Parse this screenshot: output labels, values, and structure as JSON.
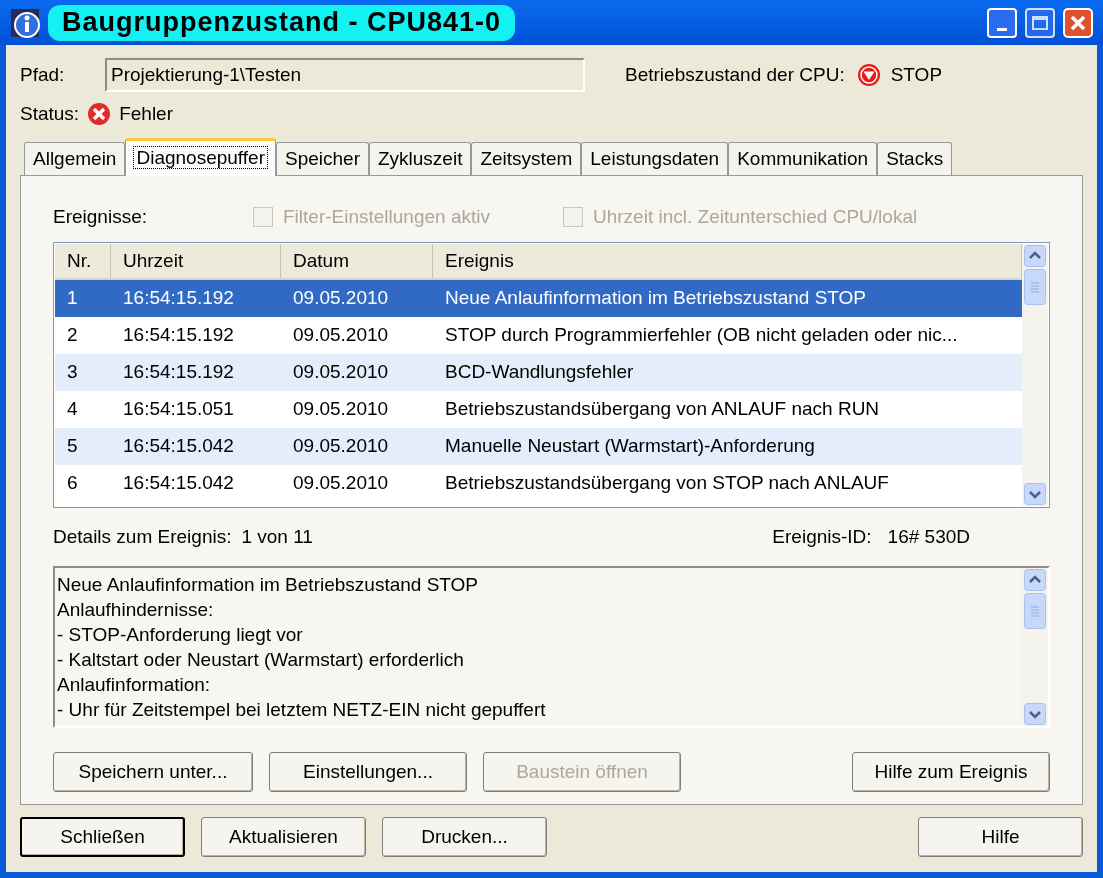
{
  "window": {
    "title": "Baugruppenzustand - CPU841-0"
  },
  "path": {
    "label": "Pfad:",
    "value": "Projektierung-1\\Testen"
  },
  "cpu_mode": {
    "label": "Betriebszustand der CPU:",
    "value": "STOP"
  },
  "status": {
    "label": "Status:",
    "value": "Fehler"
  },
  "tabs": [
    {
      "label": "Allgemein",
      "selected": false
    },
    {
      "label": "Diagnosepuffer",
      "selected": true
    },
    {
      "label": "Speicher",
      "selected": false
    },
    {
      "label": "Zykluszeit",
      "selected": false
    },
    {
      "label": "Zeitsystem",
      "selected": false
    },
    {
      "label": "Leistungsdaten",
      "selected": false
    },
    {
      "label": "Kommunikation",
      "selected": false
    },
    {
      "label": "Stacks",
      "selected": false
    }
  ],
  "events_label": "Ereignisse:",
  "checkboxes": [
    {
      "label": "Filter-Einstellungen aktiv",
      "checked": false,
      "disabled": true
    },
    {
      "label": "Uhrzeit incl. Zeitunterschied CPU/lokal",
      "checked": false,
      "disabled": true
    }
  ],
  "table": {
    "columns": [
      "Nr.",
      "Uhrzeit",
      "Datum",
      "Ereignis"
    ],
    "rows": [
      {
        "cells": [
          "1",
          "16:54:15.192",
          "09.05.2010",
          "Neue Anlaufinformation im Betriebszustand STOP"
        ],
        "selected": true
      },
      {
        "cells": [
          "2",
          "16:54:15.192",
          "09.05.2010",
          "STOP durch Programmierfehler (OB nicht geladen oder nic..."
        ],
        "selected": false
      },
      {
        "cells": [
          "3",
          "16:54:15.192",
          "09.05.2010",
          "BCD-Wandlungsfehler"
        ],
        "selected": false
      },
      {
        "cells": [
          "4",
          "16:54:15.051",
          "09.05.2010",
          "Betriebszustandsübergang von ANLAUF nach RUN"
        ],
        "selected": false
      },
      {
        "cells": [
          "5",
          "16:54:15.042",
          "09.05.2010",
          "Manuelle Neustart (Warmstart)-Anforderung"
        ],
        "selected": false
      },
      {
        "cells": [
          "6",
          "16:54:15.042",
          "09.05.2010",
          "Betriebszustandsübergang von STOP nach ANLAUF"
        ],
        "selected": false
      }
    ]
  },
  "details": {
    "label": "Details zum Ereignis:",
    "value": "1 von 11",
    "id_label": "Ereignis-ID:",
    "id_value": "16# 530D",
    "lines": [
      "Neue Anlaufinformation im Betriebszustand STOP",
      "Anlaufhindernisse:",
      "- STOP-Anforderung liegt vor",
      "- Kaltstart oder Neustart (Warmstart) erforderlich",
      "Anlaufinformation:",
      "- Uhr für Zeitstempel bei letztem NETZ-EIN nicht gepuffert"
    ]
  },
  "panel_buttons": [
    {
      "label": "Speichern unter...",
      "disabled": false
    },
    {
      "label": "Einstellungen...",
      "disabled": false
    },
    {
      "label": "Baustein öffnen",
      "disabled": true
    },
    {
      "label": "Hilfe zum Ereignis",
      "disabled": false
    }
  ],
  "buttons": [
    {
      "label": "Schließen",
      "default": true
    },
    {
      "label": "Aktualisieren",
      "default": false
    },
    {
      "label": "Drucken...",
      "default": false
    },
    {
      "label": "Hilfe",
      "default": false
    }
  ]
}
